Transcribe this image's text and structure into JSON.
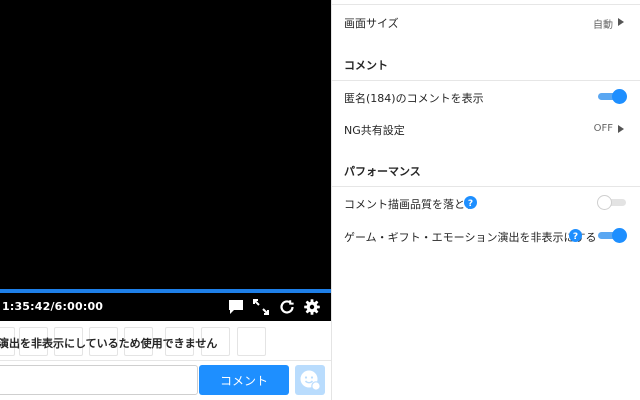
{
  "player": {
    "time": "1:35:42/6:00:00",
    "progress_fraction": 0.266,
    "notice": "演出を非表示にしているため使用できません",
    "comment_value": "",
    "comment_button": "コメント"
  },
  "settings": {
    "screen_size": {
      "label": "画面サイズ",
      "value": "自動"
    },
    "comment_section": "コメント",
    "anonymous": {
      "label": "匿名(184)のコメントを表示",
      "enabled": true
    },
    "ng_share": {
      "label": "NG共有設定",
      "value": "OFF"
    },
    "performance_section": "パフォーマンス",
    "quality": {
      "label": "コメント描画品質を落とす",
      "enabled": false
    },
    "hide_effects": {
      "label": "ゲーム・ギフト・エモーション演出を非表示にする",
      "enabled": true
    }
  },
  "colors": {
    "accent": "#1e8fff",
    "progress": "#1e7fe8",
    "video_bg": "#000000"
  },
  "icons": [
    "comment-bubble-icon",
    "fullscreen-icon",
    "reload-icon",
    "gear-icon",
    "emotion-icon",
    "help-icon",
    "chevron-right-icon"
  ]
}
